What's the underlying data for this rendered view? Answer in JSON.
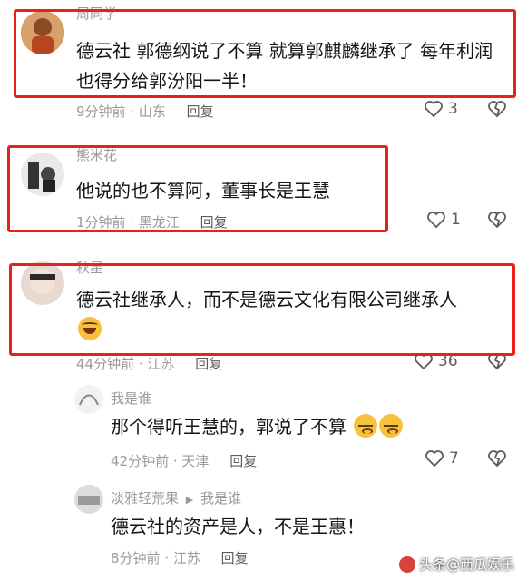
{
  "comments": [
    {
      "username": "周同学",
      "text": "德云社 郭德纲说了不算 就算郭麒麟继承了 每年利润也得分给郭汾阳一半！",
      "time": "9分钟前",
      "location": "山东",
      "reply_label": "回复",
      "likes": "3"
    },
    {
      "username": "熊米花",
      "text": "他说的也不算阿，董事长是王慧",
      "time": "1分钟前",
      "location": "黑龙江",
      "reply_label": "回复",
      "likes": "1"
    },
    {
      "username": "秋星",
      "text": "德云社继承人，而不是德云文化有限公司继承人",
      "time": "44分钟前",
      "location": "江苏",
      "reply_label": "回复",
      "likes": "36"
    },
    {
      "username": "我是谁",
      "text": "那个得听王慧的，郭说了不算",
      "time": "42分钟前",
      "location": "天津",
      "reply_label": "回复",
      "likes": "7"
    },
    {
      "username": "淡雅轻荒果",
      "reply_to": "我是谁",
      "text": "德云社的资产是人，不是王惠！",
      "time": "8分钟前",
      "location": "江苏",
      "reply_label": "回复",
      "likes": ""
    }
  ],
  "meta_separator": " · ",
  "watermark": "头条@西瓜娱乐",
  "colors": {
    "highlight_box": "#e8211a",
    "meta_gray": "#9a9a9a"
  }
}
